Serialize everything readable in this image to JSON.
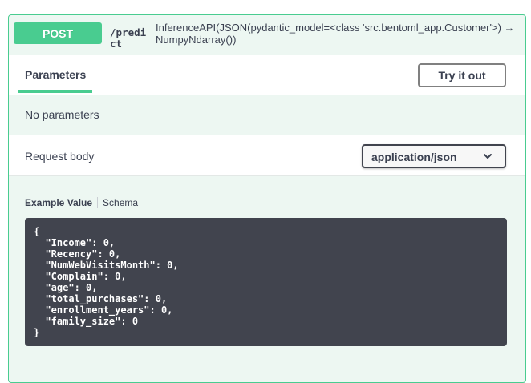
{
  "endpoint": {
    "method": "POST",
    "path": "/predict",
    "description": "InferenceAPI(JSON(pydantic_model=<class 'src.bentoml_app.Customer'>) → NumpyNdarray())"
  },
  "parameters": {
    "tab_label": "Parameters",
    "try_button": "Try it out",
    "empty_text": "No parameters"
  },
  "request_body": {
    "label": "Request body",
    "content_type": "application/json"
  },
  "model_tabs": {
    "example": "Example Value",
    "schema": "Schema"
  },
  "example_json": "{\n  \"Income\": 0,\n  \"Recency\": 0,\n  \"NumWebVisitsMonth\": 0,\n  \"Complain\": 0,\n  \"age\": 0,\n  \"total_purchases\": 0,\n  \"enrollment_years\": 0,\n  \"family_size\": 0\n}",
  "colors": {
    "post_accent": "#49cc90",
    "code_bg": "#41444e"
  }
}
